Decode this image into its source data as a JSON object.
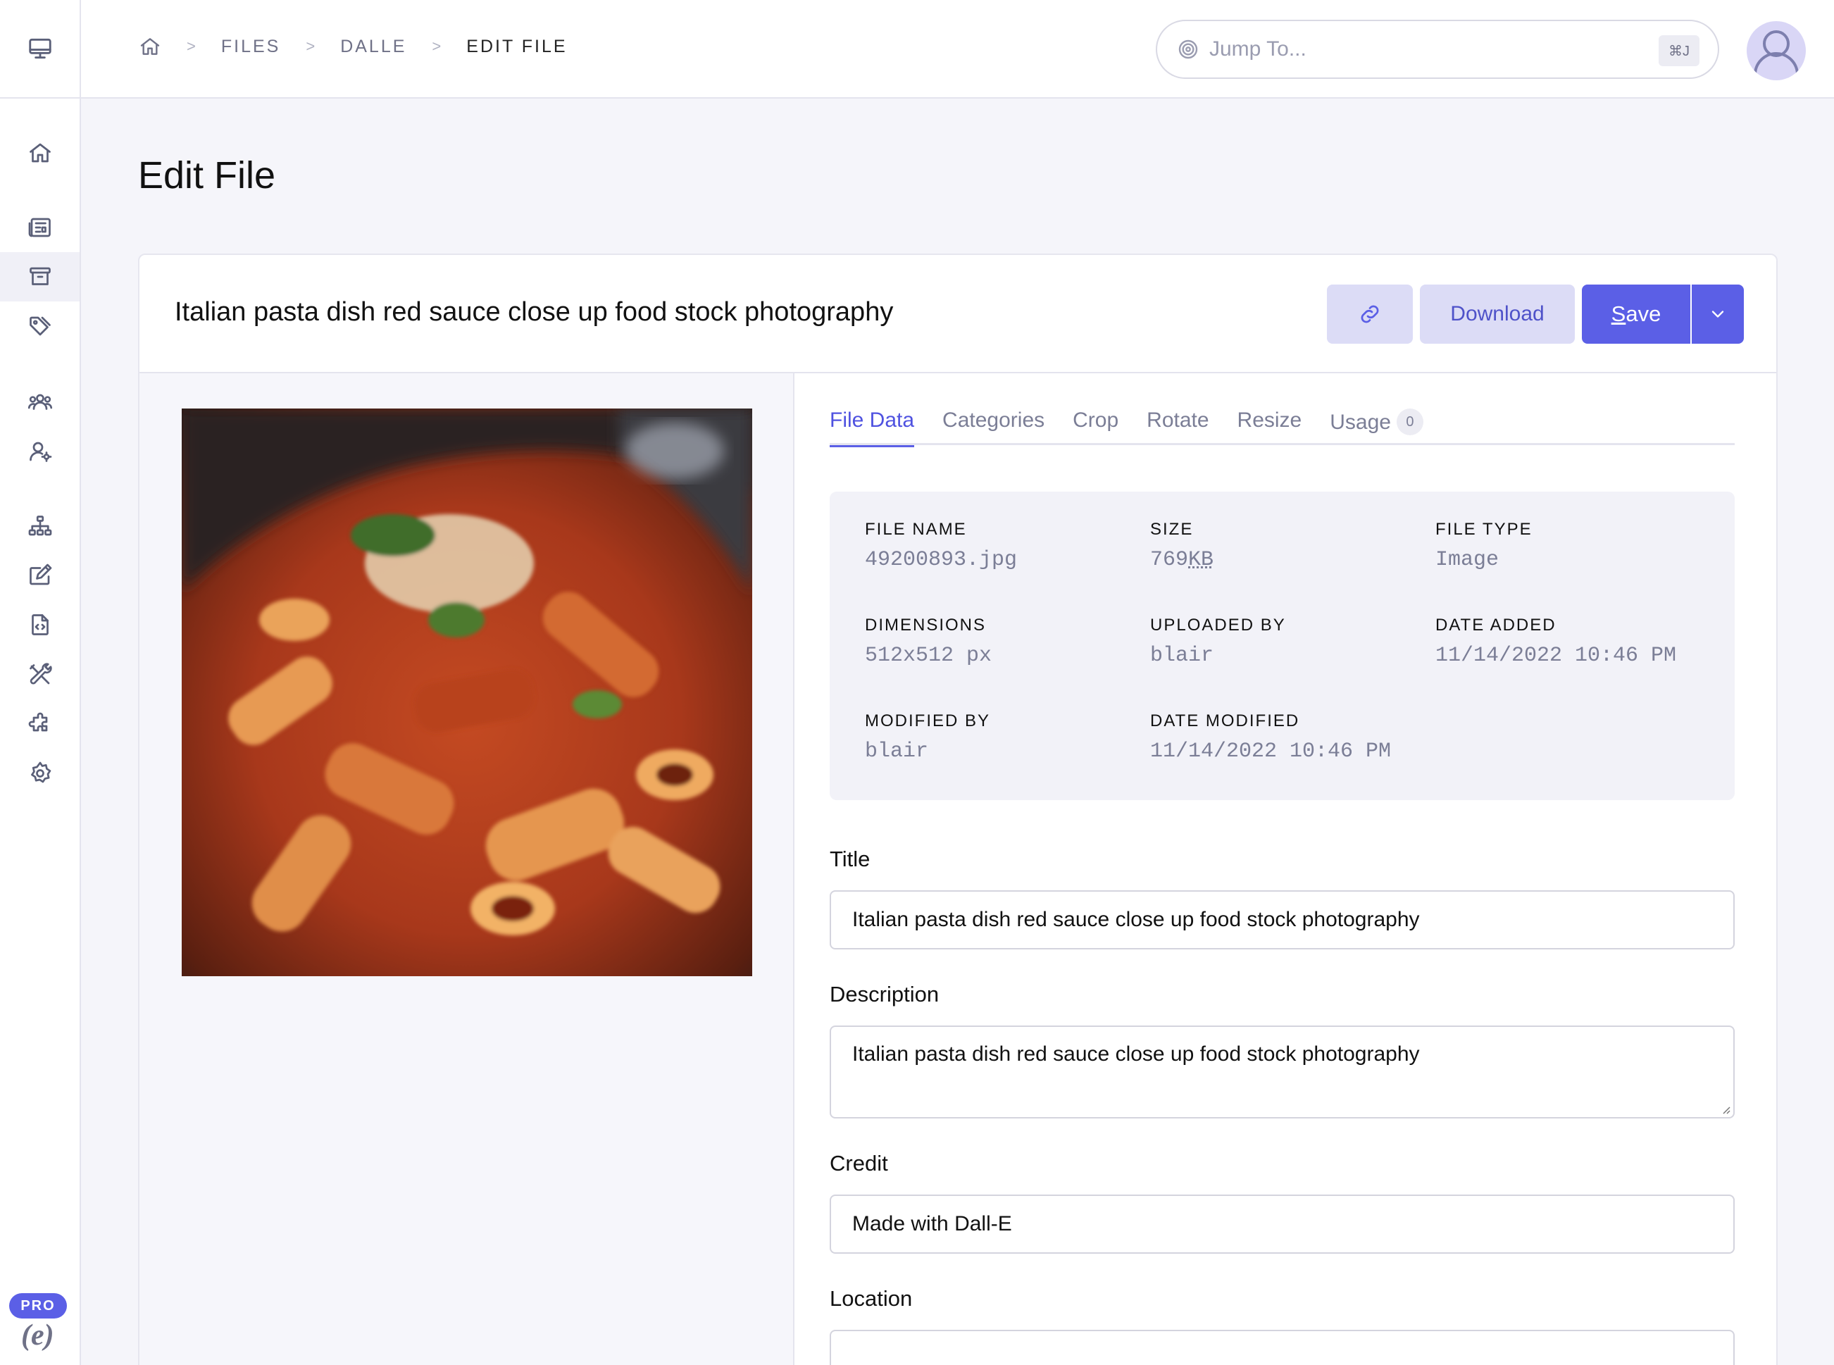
{
  "breadcrumb": {
    "items": [
      "FILES",
      "DALLE"
    ],
    "current": "EDIT FILE",
    "separator": ">"
  },
  "search": {
    "placeholder": "Jump To...",
    "shortcut": "⌘J"
  },
  "sidebar": {
    "badge": "PRO",
    "logo_text": "e",
    "icons": [
      "desktop-icon",
      "home-icon",
      "entries-icon",
      "files-icon",
      "categories-icon",
      "members-icon",
      "member-roles-icon",
      "structure-icon",
      "editor-icon",
      "templates-icon",
      "tools-icon",
      "addons-icon",
      "settings-icon"
    ],
    "active": "files-icon"
  },
  "page": {
    "title": "Edit File"
  },
  "file": {
    "heading": "Italian pasta dish red sauce close up food stock photography"
  },
  "toolbar": {
    "download_label": "Download",
    "save_label_rest": "ave",
    "save_label_first": "S"
  },
  "tabs": [
    {
      "label": "File Data"
    },
    {
      "label": "Categories"
    },
    {
      "label": "Crop"
    },
    {
      "label": "Rotate"
    },
    {
      "label": "Resize"
    },
    {
      "label": "Usage",
      "count": "0"
    }
  ],
  "meta": {
    "file_name": {
      "label": "FILE NAME",
      "value": "49200893.jpg"
    },
    "size": {
      "label": "SIZE",
      "value": "769",
      "unit": "KB"
    },
    "file_type": {
      "label": "FILE TYPE",
      "value": "Image"
    },
    "dimensions": {
      "label": "DIMENSIONS",
      "value": "512x512 px"
    },
    "uploaded_by": {
      "label": "UPLOADED BY",
      "value": "blair"
    },
    "date_added": {
      "label": "DATE ADDED",
      "value": "11/14/2022 10:46 PM"
    },
    "modified_by": {
      "label": "MODIFIED BY",
      "value": "blair"
    },
    "date_modified": {
      "label": "DATE MODIFIED",
      "value": "11/14/2022 10:46 PM"
    }
  },
  "form": {
    "title_label": "Title",
    "title_value": "Italian pasta dish red sauce close up food stock photography",
    "description_label": "Description",
    "description_value": "Italian pasta dish red sauce close up food stock photography",
    "credit_label": "Credit",
    "credit_value": "Made with Dall-E",
    "location_label": "Location",
    "location_value": ""
  },
  "colors": {
    "accent": "#5b5fe6",
    "accent_light": "#dcdcf6",
    "background": "#f5f5fa"
  }
}
